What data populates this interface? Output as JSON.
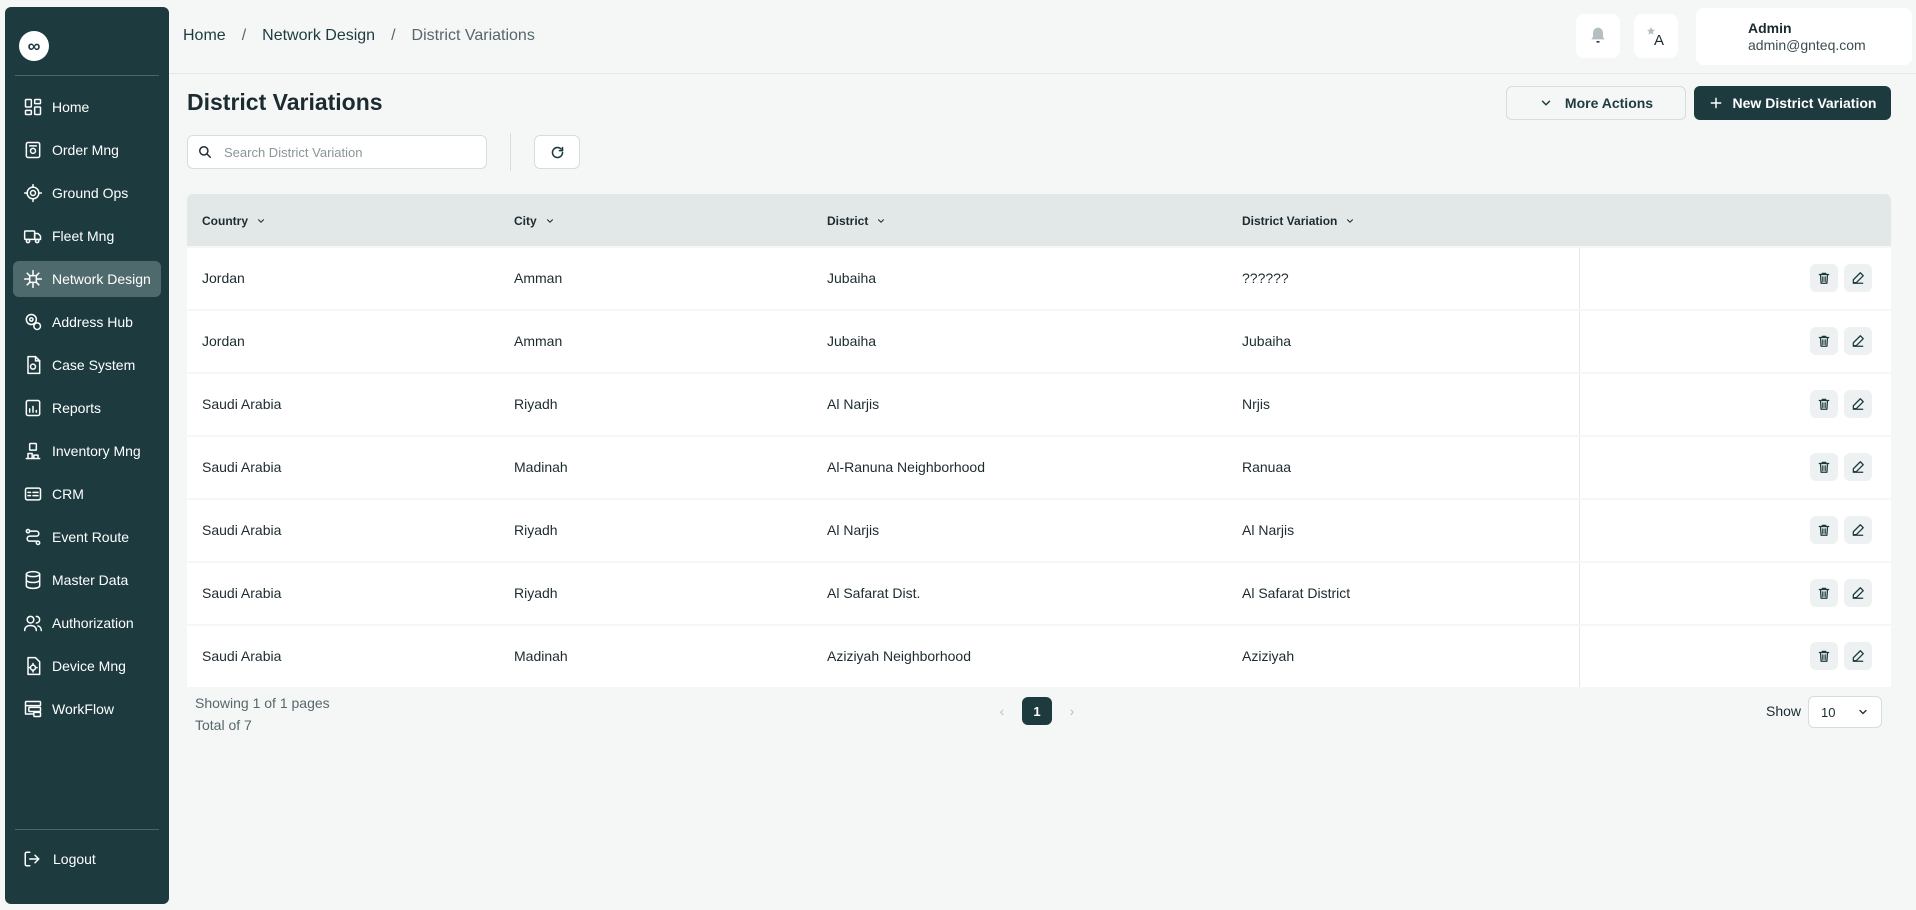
{
  "sidebar": {
    "logo_glyph": "∞",
    "items": [
      {
        "label": "Home",
        "icon": "dashboard-icon",
        "active": false
      },
      {
        "label": "Order Mng",
        "icon": "order-icon",
        "active": false
      },
      {
        "label": "Ground Ops",
        "icon": "ground-ops-icon",
        "active": false
      },
      {
        "label": "Fleet Mng",
        "icon": "truck-icon",
        "active": false
      },
      {
        "label": "Network Design",
        "icon": "network-icon",
        "active": true
      },
      {
        "label": "Address Hub",
        "icon": "location-icon",
        "active": false
      },
      {
        "label": "Case System",
        "icon": "case-icon",
        "active": false
      },
      {
        "label": "Reports",
        "icon": "reports-icon",
        "active": false
      },
      {
        "label": "Inventory Mng",
        "icon": "inventory-icon",
        "active": false
      },
      {
        "label": "CRM",
        "icon": "crm-icon",
        "active": false
      },
      {
        "label": "Event Route",
        "icon": "route-icon",
        "active": false
      },
      {
        "label": "Master Data",
        "icon": "database-icon",
        "active": false
      },
      {
        "label": "Authorization",
        "icon": "users-icon",
        "active": false
      },
      {
        "label": "Device Mng",
        "icon": "device-icon",
        "active": false
      },
      {
        "label": "WorkFlow",
        "icon": "workflow-icon",
        "active": false
      }
    ],
    "logout_label": "Logout"
  },
  "breadcrumb": {
    "items": [
      "Home",
      "Network Design",
      "District Variations"
    ],
    "separator": "/"
  },
  "user": {
    "name": "Admin",
    "email": "admin@gnteq.com"
  },
  "page": {
    "title": "District Variations",
    "more_actions_label": "More Actions",
    "new_button_label": "New District Variation"
  },
  "search": {
    "placeholder": "Search District Variation",
    "value": ""
  },
  "table": {
    "columns": [
      "Country",
      "City",
      "District",
      "District Variation"
    ],
    "rows": [
      [
        "Jordan",
        "Amman",
        "Jubaiha",
        "??????"
      ],
      [
        "Jordan",
        "Amman",
        "Jubaiha",
        "Jubaiha"
      ],
      [
        "Saudi Arabia",
        "Riyadh",
        "Al Narjis",
        "Nrjis"
      ],
      [
        "Saudi Arabia",
        "Madinah",
        "Al-Ranuna Neighborhood",
        "Ranuaa"
      ],
      [
        "Saudi Arabia",
        "Riyadh",
        "Al Narjis",
        "Al Narjis"
      ],
      [
        "Saudi Arabia",
        "Riyadh",
        "Al Safarat Dist.",
        "Al Safarat District"
      ],
      [
        "Saudi Arabia",
        "Madinah",
        "Aziziyah Neighborhood",
        "Aziziyah"
      ]
    ]
  },
  "footer": {
    "showing_text": "Showing 1 of 1 pages",
    "total_text": "Total of 7",
    "current_page": "1",
    "show_label": "Show",
    "page_size": "10"
  },
  "colors": {
    "brand": "#1d3b3f",
    "active_nav": "#4f6a6d",
    "background": "#f5f7f7",
    "header_row": "#e2e7e8"
  }
}
